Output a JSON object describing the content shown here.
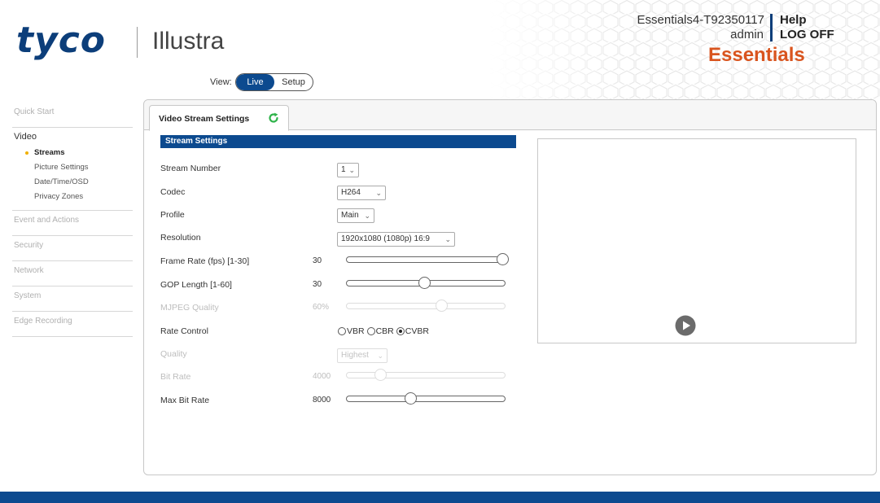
{
  "header": {
    "brand": "tyco",
    "product": "Illustra",
    "device_name": "Essentials4-T92350117",
    "user": "admin",
    "help_label": "Help",
    "logoff_label": "LOG OFF",
    "edition": "Essentials",
    "view_label": "View:",
    "view_options": [
      "Live",
      "Setup"
    ],
    "view_selected": "Live"
  },
  "sidebar": {
    "quick_start": "Quick Start",
    "video": "Video",
    "video_items": [
      "Streams",
      "Picture Settings",
      "Date/Time/OSD",
      "Privacy Zones"
    ],
    "active_item": "Streams",
    "sections": [
      "Event and Actions",
      "Security",
      "Network",
      "System",
      "Edge Recording"
    ]
  },
  "content": {
    "tab_label": "Video Stream Settings",
    "section_title": "Stream Settings",
    "fields": {
      "stream_number": {
        "label": "Stream Number",
        "value": "1"
      },
      "codec": {
        "label": "Codec",
        "value": "H264"
      },
      "profile": {
        "label": "Profile",
        "value": "Main"
      },
      "resolution": {
        "label": "Resolution",
        "value": "1920x1080 (1080p) 16:9"
      },
      "frame_rate": {
        "label": "Frame Rate (fps) [1-30]",
        "value": "30",
        "fraction": 1.0
      },
      "gop_length": {
        "label": "GOP Length [1-60]",
        "value": "30",
        "fraction": 0.49
      },
      "mjpeg_quality": {
        "label": "MJPEG Quality",
        "value": "60%",
        "fraction": 0.6
      },
      "rate_control": {
        "label": "Rate Control",
        "options": [
          "VBR",
          "CBR",
          "CVBR"
        ],
        "selected": "CVBR"
      },
      "quality": {
        "label": "Quality",
        "value": "Highest"
      },
      "bit_rate": {
        "label": "Bit Rate",
        "value": "4000",
        "fraction": 0.2
      },
      "max_bit_rate": {
        "label": "Max Bit Rate",
        "value": "8000",
        "fraction": 0.4
      }
    }
  },
  "colors": {
    "brand_blue": "#0c4a8f",
    "logo_blue": "#0c3e7a",
    "accent_orange": "#d9541e",
    "refresh_green": "#2eb34a",
    "bullet_yellow": "#f0b000"
  },
  "icons": {
    "refresh": "refresh-icon",
    "play": "play-icon"
  }
}
